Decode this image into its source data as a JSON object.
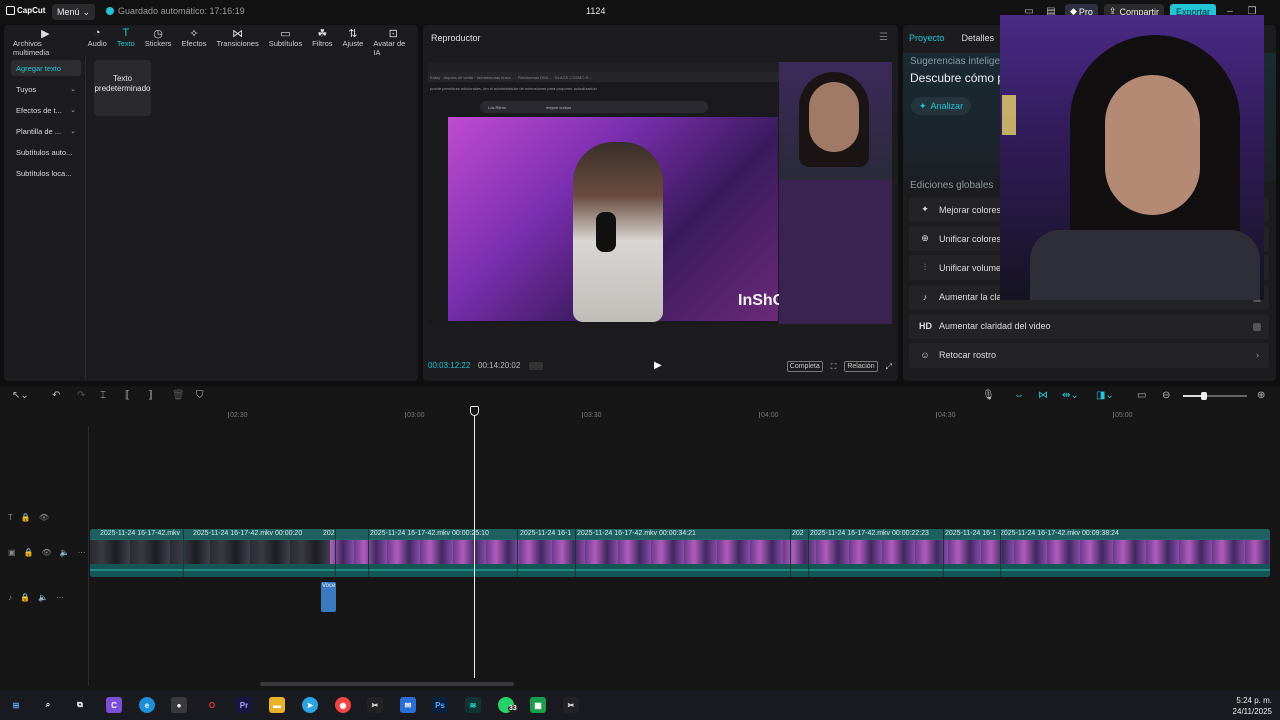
{
  "app": {
    "logo_text": "CapCut",
    "menu_label": "Menú",
    "autosave_text": "Guardado automático: 17:16:19",
    "project_title": "1124",
    "pro_label": "Pro",
    "share_label": "Compartir",
    "export_label": "Exportar"
  },
  "toolbar": {
    "tools": [
      {
        "label": "Archivos multimedia",
        "icon": "media-icon"
      },
      {
        "label": "Audio",
        "icon": "audio-icon"
      },
      {
        "label": "Texto",
        "icon": "text-icon",
        "active": true
      },
      {
        "label": "Stickers",
        "icon": "sticker-icon"
      },
      {
        "label": "Efectos",
        "icon": "effects-icon"
      },
      {
        "label": "Transiciones",
        "icon": "transitions-icon"
      },
      {
        "label": "Subtítulos",
        "icon": "subtitles-icon"
      },
      {
        "label": "Filtros",
        "icon": "filters-icon"
      },
      {
        "label": "Ajuste",
        "icon": "adjust-icon"
      },
      {
        "label": "Avatar de IA",
        "icon": "ai-avatar-icon"
      }
    ]
  },
  "sidebar": {
    "items": [
      {
        "label": "Agregar texto",
        "active": true
      },
      {
        "label": "Tuyos"
      },
      {
        "label": "Efectos de t..."
      },
      {
        "label": "Plantilla de ..."
      },
      {
        "label": "Subtítulos auto..."
      },
      {
        "label": "Subtítulos loca..."
      }
    ],
    "preset_card": "Texto predeterminado"
  },
  "player": {
    "title": "Reproductor",
    "current_time": "00:03:12:22",
    "total_time": "00:14:20:02",
    "full_label": "Completa",
    "ratio_label": "Relación",
    "video": {
      "search_left": "Los Ritmo",
      "search_right": "mejore cursos",
      "watermark": "InShOt",
      "browser_line1": "Kafay · Alquies de venta · herramientas buscr... · Plataformas DIGI... · BLACK COSMO R...",
      "browser_line2": "puede permitirse adicionales, ten el administrador de extensiones para proponer actualización"
    }
  },
  "properties": {
    "tabs": [
      {
        "label": "Proyecto",
        "active": true
      },
      {
        "label": "Detalles"
      }
    ],
    "suggest_title": "Sugerencias inteligentes",
    "suggest_text": "Descubre cómo p",
    "analyze_label": "Analizar",
    "global_title": "Ediciones globales",
    "items": [
      {
        "label": "Mejorar colores",
        "icon": "color-enhance-icon"
      },
      {
        "label": "Unificar colores",
        "icon": "color-unify-icon"
      },
      {
        "label": "Unificar volumen",
        "icon": "volume-unify-icon"
      },
      {
        "label": "Aumentar la claridad de la voz",
        "icon": "voice-clarity-icon"
      },
      {
        "label": "Aumentar claridad del video",
        "icon": "hd-icon",
        "icon_text": "HD"
      },
      {
        "label": "Retocar rostro",
        "icon": "retouch-face-icon"
      }
    ]
  },
  "timeline": {
    "ruler": [
      "02:30",
      "03:00",
      "03:30",
      "04:00",
      "04:30",
      "05:00"
    ],
    "clip_labels": [
      "2025-11-24 16-17-42.mkv",
      "2025-11-24 16-17-42.mkv  00:00:20",
      "202",
      "2025-11-24 16-17-42.mkv  00:00:25:10",
      "2025-11-24 16-1",
      "2025-11-24 16-17-42.mkv  00:00:34:21",
      "202",
      "2025-11-24 16-17-42.mkv  00:00:22:23",
      "2025-11-24 16-1",
      "2025-11-24 16-17-42.mkv  00:09:38:24"
    ],
    "voice_clip": "Voce"
  },
  "taskbar": {
    "time": "5:24 p. m.",
    "date": "24/11/2025",
    "whatsapp_badge": "33"
  },
  "colors": {
    "accent": "#22c5d6",
    "panel": "#1c1c1e",
    "track": "#1f6b6b"
  }
}
